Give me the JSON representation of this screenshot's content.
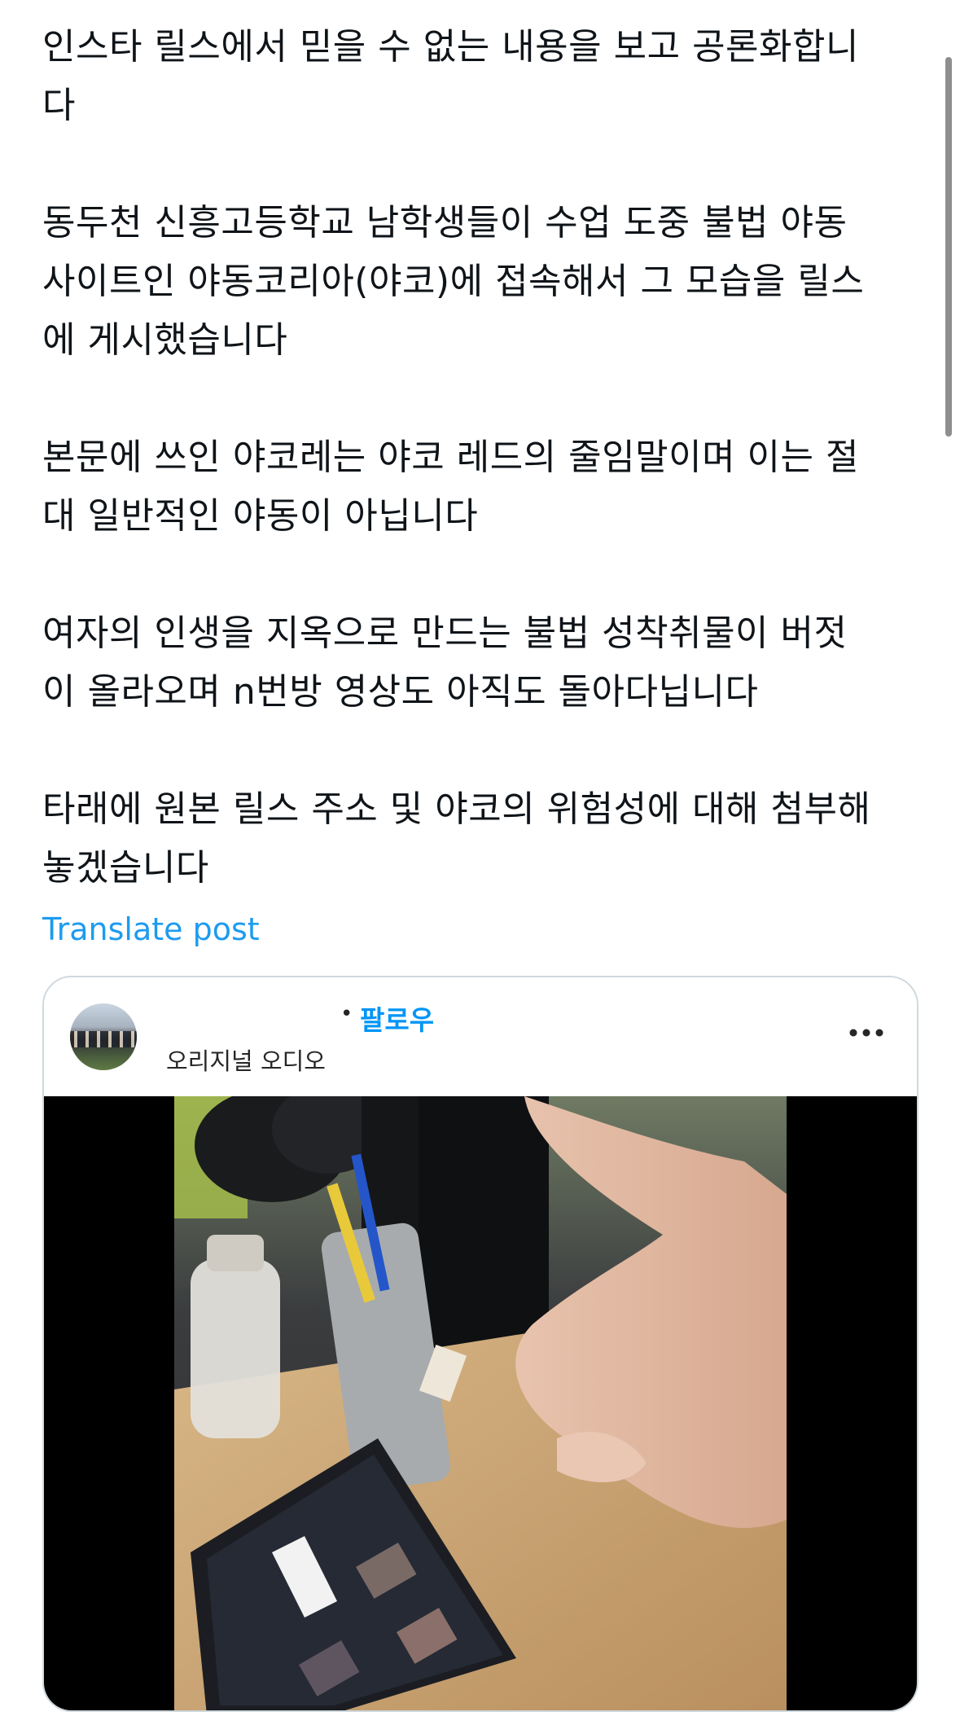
{
  "post": {
    "paragraphs": [
      "인스타 릴스에서 믿을 수 없는 내용을 보고 공론화합니\n다",
      "동두천 신흥고등학교 남학생들이 수업 도중 불법 야동\n사이트인 야동코리아(야코)에 접속해서 그 모습을 릴스\n에 게시했습니다",
      "본문에 쓰인 야코레는 야코 레드의 줄임말이며 이는 절\n대 일반적인 야동이 아닙니다",
      "여자의 인생을 지옥으로 만드는 불법 성착취물이 버젓\n이 올라오며 n번방 영상도 아직도 돌아다닙니다",
      "타래에 원본 릴스 주소 및 야코의 위험성에 대해 첨부해\n놓겠습니다"
    ],
    "translate_label": "Translate post"
  },
  "embed": {
    "follow_separator": "•",
    "follow_label": "팔로우",
    "audio_label": "오리지널 오디오",
    "more_icon": "more-horizontal-icon"
  },
  "colors": {
    "link": "#1d9bf0",
    "instagram_blue": "#0095f6",
    "card_border": "#cfd9de"
  }
}
